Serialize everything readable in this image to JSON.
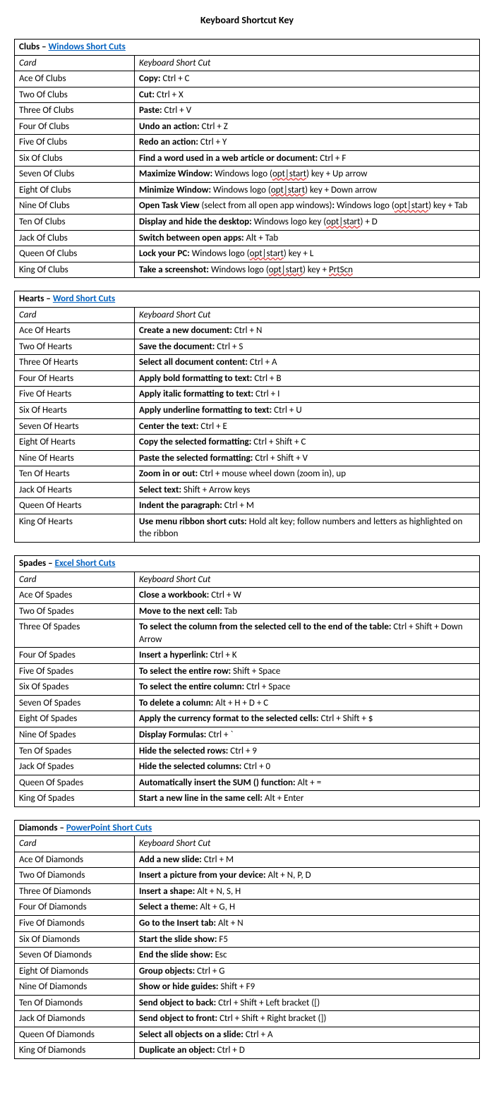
{
  "title": "Keyboard Shortcut Key",
  "col_labels": {
    "card": "Card",
    "shortcut": "Keyboard Short Cut"
  },
  "sections": [
    {
      "suit_prefix": "Clubs – ",
      "link_text": "Windows Short Cuts",
      "rows": [
        {
          "card": "Ace Of Clubs",
          "bold": "Copy:",
          "rest": " Ctrl + C"
        },
        {
          "card": "Two Of Clubs",
          "bold": "Cut:",
          "rest": " Ctrl + X"
        },
        {
          "card": "Three Of Clubs",
          "bold": "Paste:",
          "rest": " Ctrl + V"
        },
        {
          "card": "Four Of Clubs",
          "bold": "Undo an action:",
          "rest": " Ctrl + Z"
        },
        {
          "card": "Five Of Clubs",
          "bold": "Redo an action:",
          "rest": " Ctrl + Y"
        },
        {
          "card": "Six Of Clubs",
          "bold": "Find a word used in a web article or document:",
          "rest": " Ctrl + F"
        },
        {
          "card": "Seven Of Clubs",
          "bold": "Maximize Window:",
          "html": " Windows logo (<span class=\"sp\">opt|start</span>) key + Up arrow"
        },
        {
          "card": "Eight Of Clubs",
          "bold": "Minimize Window:",
          "html": " Windows logo (<span class=\"sp\">opt|start</span>) key + Down arrow"
        },
        {
          "card": "Nine Of Clubs",
          "bold": "Open Task View",
          "html": " (select from all open app windows)<b>:</b> Windows logo (<span class=\"sp\">opt|start</span>) key + Tab"
        },
        {
          "card": "Ten Of Clubs",
          "bold": "Display and hide the desktop:",
          "html": " Windows logo key (<span class=\"sp\">opt|start</span>) + D"
        },
        {
          "card": "Jack Of Clubs",
          "bold": "Switch between open apps:",
          "rest": " Alt + Tab"
        },
        {
          "card": "Queen Of Clubs",
          "bold": "Lock your PC:",
          "html": " Windows logo (<span class=\"sp\">opt|start</span>) key + L"
        },
        {
          "card": "King Of Clubs",
          "bold": "Take a screenshot:",
          "html": " Windows logo (<span class=\"sp\">opt|start</span>) key + <span class=\"sp\">PrtScn</span>"
        }
      ]
    },
    {
      "suit_prefix": "Hearts – ",
      "link_text": "Word Short Cuts",
      "rows": [
        {
          "card": "Ace Of Hearts",
          "bold": "Create a new document:",
          "rest": " Ctrl + N"
        },
        {
          "card": "Two Of Hearts",
          "bold": "Save the document:",
          "rest": " Ctrl + S"
        },
        {
          "card": "Three Of Hearts",
          "bold": "Select all document content:",
          "rest": " Ctrl + A"
        },
        {
          "card": "Four Of Hearts",
          "bold": "Apply bold formatting to text:",
          "rest": " Ctrl + B"
        },
        {
          "card": "Five Of Hearts",
          "bold": "Apply italic formatting to text:",
          "rest": " Ctrl + I"
        },
        {
          "card": "Six Of Hearts",
          "bold": "Apply underline formatting to text:",
          "rest": " Ctrl + U"
        },
        {
          "card": "Seven Of Hearts",
          "bold": "Center the text:",
          "rest": " Ctrl + E"
        },
        {
          "card": "Eight Of Hearts",
          "bold": "Copy the selected formatting:",
          "rest": " Ctrl + Shift + C"
        },
        {
          "card": "Nine Of Hearts",
          "bold": "Paste the selected formatting:",
          "rest": " Ctrl + Shift + V"
        },
        {
          "card": "Ten Of Hearts",
          "bold": "Zoom in or out:",
          "rest": " Ctrl + mouse wheel down (zoom in), up"
        },
        {
          "card": "Jack Of Hearts",
          "bold": "Select text:",
          "rest": " Shift + Arrow keys"
        },
        {
          "card": "Queen Of Hearts",
          "bold": "Indent the paragraph:",
          "rest": " Ctrl + M"
        },
        {
          "card": "King Of Hearts",
          "bold": "Use menu ribbon short cuts:",
          "rest": " Hold alt key; follow numbers and letters as highlighted on the ribbon"
        }
      ]
    },
    {
      "suit_prefix": "Spades – ",
      "link_text": "Excel Short Cuts",
      "rows": [
        {
          "card": "Ace Of Spades",
          "bold": "Close a workbook:",
          "rest": " Ctrl + W"
        },
        {
          "card": "Two Of Spades",
          "bold": "Move to the next cell:",
          "rest": " Tab"
        },
        {
          "card": "Three Of Spades",
          "bold": "To select the column from the selected cell to the end of the table:",
          "rest": " Ctrl + Shift + Down Arrow"
        },
        {
          "card": "Four Of Spades",
          "bold": "Insert a hyperlink:",
          "rest": " Ctrl + K"
        },
        {
          "card": "Five Of Spades",
          "bold": "To select the entire row:",
          "rest": " Shift + Space"
        },
        {
          "card": "Six Of Spades",
          "bold": "To select the entire column:",
          "rest": " Ctrl + Space"
        },
        {
          "card": "Seven Of Spades",
          "bold": "To delete a column:",
          "rest": " Alt + H + D + C"
        },
        {
          "card": "Eight Of Spades",
          "bold": "Apply the currency format to the selected cells:",
          "rest": " Ctrl + Shift + $"
        },
        {
          "card": "Nine Of Spades",
          "bold": "Display Formulas:",
          "rest": " Ctrl + `"
        },
        {
          "card": "Ten Of Spades",
          "bold": "Hide the selected rows:",
          "rest": " Ctrl + 9"
        },
        {
          "card": "Jack Of Spades",
          "bold": "Hide the selected columns:",
          "rest": " Ctrl + 0"
        },
        {
          "card": "Queen Of Spades",
          "bold": "Automatically insert the SUM () function:",
          "rest": " Alt + ="
        },
        {
          "card": "King Of Spades",
          "bold": "Start a new line in the same cell:",
          "rest": " Alt + Enter"
        }
      ]
    },
    {
      "suit_prefix": "Diamonds – ",
      "link_text": "PowerPoint Short Cuts",
      "rows": [
        {
          "card": "Ace Of Diamonds",
          "bold": "Add a new slide:",
          "rest": " Ctrl + M"
        },
        {
          "card": "Two Of Diamonds",
          "bold": "Insert a picture from your device:",
          "rest": " Alt + N, P, D"
        },
        {
          "card": "Three Of Diamonds",
          "bold": "Insert a shape:",
          "rest": " Alt + N, S, H"
        },
        {
          "card": "Four Of Diamonds",
          "bold": "Select a theme:",
          "rest": " Alt + G, H"
        },
        {
          "card": "Five Of Diamonds",
          "bold": "Go to the Insert tab:",
          "rest": " Alt + N"
        },
        {
          "card": "Six Of Diamonds",
          "bold": "Start the slide show:",
          "rest": " F5"
        },
        {
          "card": "Seven Of Diamonds",
          "bold": "End the slide show:",
          "rest": " Esc"
        },
        {
          "card": "Eight Of Diamonds",
          "bold": "Group objects:",
          "rest": " Ctrl + G"
        },
        {
          "card": "Nine Of Diamonds",
          "bold": "Show or hide guides:",
          "rest": " Shift + F9"
        },
        {
          "card": "Ten Of Diamonds",
          "bold": "Send object to back:",
          "rest": " Ctrl + Shift + Left bracket ([)"
        },
        {
          "card": "Jack Of Diamonds",
          "bold": "Send object to front:",
          "rest": " Ctrl + Shift + Right bracket (])"
        },
        {
          "card": "Queen Of Diamonds",
          "bold": "Select all objects on a slide:",
          "rest": " Ctrl + A"
        },
        {
          "card": "King Of Diamonds",
          "bold": "Duplicate an object:",
          "rest": " Ctrl + D"
        }
      ]
    }
  ]
}
